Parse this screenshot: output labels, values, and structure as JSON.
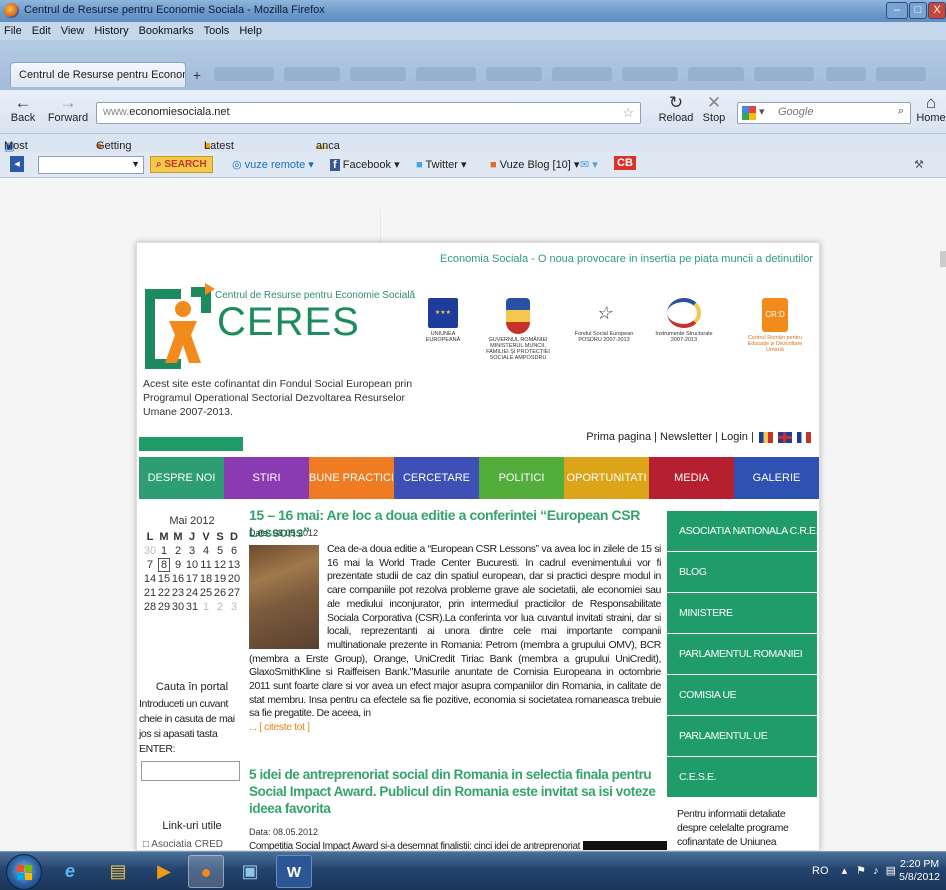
{
  "window": {
    "title": "Centrul de Resurse pentru Economie Sociala - Mozilla Firefox",
    "controls": [
      "–",
      "□",
      "X"
    ]
  },
  "menu": [
    "File",
    "Edit",
    "View",
    "History",
    "Bookmarks",
    "Tools",
    "Help"
  ],
  "tab": {
    "label": "Centrul de Resurse pentru Economie Soc...",
    "new": "+"
  },
  "nav": {
    "back": "Back",
    "forward": "Forward",
    "url_prefix": "www.",
    "url_host": "economiesociala.net",
    "reload": "Reload",
    "stop": "Stop",
    "search_placeholder": "Google",
    "home": "Home"
  },
  "bookmarks": [
    "Most Visited",
    "Getting Started",
    "Latest Headlines",
    "anca"
  ],
  "vuze": {
    "search_button": "SEARCH",
    "remote": "vuze remote",
    "facebook": "Facebook",
    "twitter": "Twitter",
    "blog": "Vuze Blog [10]",
    "cb": "CB"
  },
  "site": {
    "slogan": "Economia Sociala - O noua provocare in insertia pe piata muncii a detinutilor",
    "center_name": "Centrul de Resurse pentru Economie Socială",
    "brand": "CERES",
    "intro": "Acest site este cofinantat din Fondul Social European prin Programul Operational Sectorial Dezvoltarea Resurselor Umane 2007-2013.",
    "partner_logos": [
      {
        "name": "UNIUNEA EUROPEANĂ"
      },
      {
        "name": "GUVERNUL ROMÂNIEI MINISTERUL MUNCII, FAMILIEI ȘI PROTECȚIEI SOCIALE AMPOSDRU"
      },
      {
        "name": "Fondul Social European POSDRU 2007-2013"
      },
      {
        "name": "Instrumente Structurale 2007-2013"
      },
      {
        "name": "Centrul Român pentru Educație și Dezvoltare Umană"
      }
    ],
    "top_links": "Prima pagina | Newsletter | Login |",
    "nav": [
      {
        "label": "DESPRE NOI",
        "color": "#2c9d74"
      },
      {
        "label": "STIRI",
        "color": "#8b3bb2"
      },
      {
        "label": "BUNE PRACTICI",
        "color": "#ef7b22"
      },
      {
        "label": "CERCETARE",
        "color": "#3e4fb6"
      },
      {
        "label": "POLITICI",
        "color": "#52ad3b"
      },
      {
        "label": "OPORTUNITATI",
        "color": "#dca418"
      },
      {
        "label": "MEDIA",
        "color": "#b51f2f"
      },
      {
        "label": "GALERIE",
        "color": "#2f52b2"
      }
    ],
    "calendar": {
      "title": "Mai 2012",
      "weekdays": [
        "L",
        "M",
        "M",
        "J",
        "V",
        "S",
        "D"
      ],
      "weeks": [
        [
          "30",
          "1",
          "2",
          "3",
          "4",
          "5",
          "6"
        ],
        [
          "7",
          "8",
          "9",
          "10",
          "11",
          "12",
          "13"
        ],
        [
          "14",
          "15",
          "16",
          "17",
          "18",
          "19",
          "20"
        ],
        [
          "21",
          "22",
          "23",
          "24",
          "25",
          "26",
          "27"
        ],
        [
          "28",
          "29",
          "30",
          "31",
          "1",
          "2",
          "3"
        ]
      ]
    },
    "search_title": "Cauta în portal",
    "search_hint": "Introduceti un cuvant cheie in casuta de mai jos si apasati tasta ENTER:",
    "links_title": "Link-uri utile",
    "links_first": "Asociatia CRED",
    "articles": [
      {
        "title": "15 – 16 mai: Are loc a doua editie a conferintei “European CSR Lessons”",
        "date": "Data: 08.05.2012",
        "body": "Cea de-a doua editie a “European CSR Lessons” va avea loc in zilele de 15 si 16 mai la World Trade Center Bucuresti. In cadrul evenimentului vor fi prezentate studii de caz din spatiul european, dar si practici despre modul in care companiile pot rezolva probleme grave ale societatii, ale economiei sau ale mediului inconjurator, prin intermediul practicilor de Responsabilitate Sociala Corporativa (CSR).La conferinta vor lua cuvantul invitati straini, dar si locali, reprezentanti ai unora dintre cele mai importante companii multinationale prezente in Romania: Petrom (membra a grupului OMV), BCR (membra a Erste Group), Orange, UniCredit Tiriac Bank (membra a grupului UniCredit), GlaxoSmithKline si Raiffeisen Bank.\"Masurile anuntate de Comisia Europeana in octombrie 2011 sunt foarte clare si vor avea un efect major asupra companiilor din Romania, in calitate de stat membru. Insa pentru ca efectele sa fie pozitive, economia si societatea romaneasca trebuie sa fie pregatite. De aceea, in",
        "read_more": "... [ citeste tot ]"
      },
      {
        "title": "5 idei de antreprenoriat social din Romania in selectia finala pentru Social Impact Award. Publicul din Romania este invitat sa isi voteze ideea favorita",
        "date": "Data: 08.05.2012",
        "body": "Competitia Social Impact Award si-a desemnat finalistii: cinci idei de antreprenoriat"
      }
    ],
    "right_nav": [
      "ASOCIATIA NATIONALA C.R.E.S.",
      "BLOG",
      "MINISTERE",
      "PARLAMENTUL ROMANIEI",
      "COMISIA UE",
      "PARLAMENTUL UE",
      "C.E.S.E."
    ],
    "right_note": "Pentru informatii detaliate despre celelalte programe cofinantate de Uniunea Europeana, va invitam sa"
  },
  "taskbar": {
    "lang": "RO",
    "time": "2:20 PM",
    "date": "5/8/2012"
  }
}
